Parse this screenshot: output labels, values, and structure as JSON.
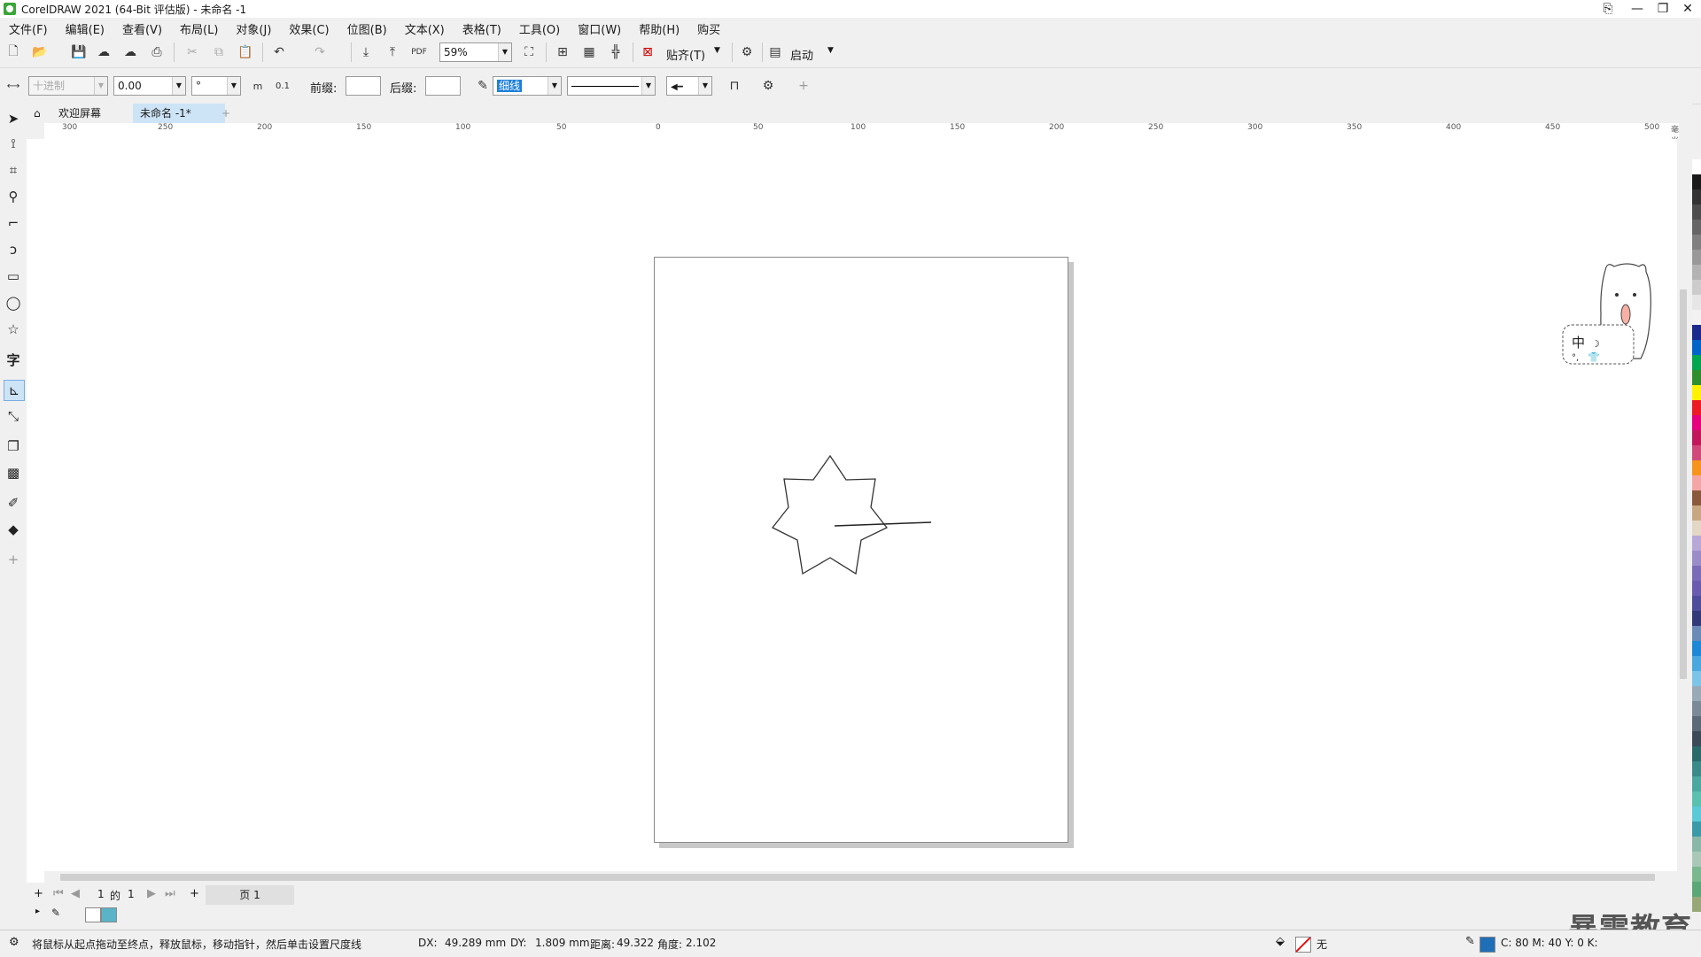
{
  "window": {
    "title": "CorelDRAW 2021 (64-Bit 评估版) - 未命名 -1"
  },
  "menu": [
    "文件(F)",
    "编辑(E)",
    "查看(V)",
    "布局(L)",
    "对象(J)",
    "效果(C)",
    "位图(B)",
    "文本(X)",
    "表格(T)",
    "工具(O)",
    "窗口(W)",
    "帮助(H)",
    "购买"
  ],
  "toolbar": {
    "zoom": "59%",
    "snap_label": "贴齐(T)",
    "launch_label": "启动"
  },
  "property_bar": {
    "units": "十进制",
    "value": "0.00",
    "degree": "°",
    "prefix_label": "前缀:",
    "suffix_label": "后缀:",
    "outline": "细线",
    "decimal_hint": "0.1",
    "unit_hint": "m"
  },
  "tabs": {
    "welcome": "欢迎屏幕",
    "document": "未命名 -1*"
  },
  "ruler_h": [
    "300",
    "250",
    "200",
    "150",
    "100",
    "50",
    "0",
    "50",
    "100",
    "150",
    "200",
    "250",
    "300",
    "350",
    "400",
    "450",
    "500"
  ],
  "ruler_h_unit": "毫米",
  "page_nav": {
    "current": "1",
    "of": "的",
    "total": "1",
    "page_tab": "页 1"
  },
  "status": {
    "hint": "将鼠标从起点拖动至终点，释放鼠标，移动指针，然后单击设置尺度线",
    "dx_label": "DX:",
    "dx": "49.289 mm",
    "dy_label": "DY:",
    "dy": "1.809 mm",
    "dist_label": "距离:",
    "dist": "49.322",
    "angle_label": "角度:",
    "angle": "2.102",
    "fill_none": "无",
    "cmyk": "C: 80 M: 40 Y: 0 K:"
  },
  "ime": {
    "lang": "中"
  },
  "watermark": "暴需教育",
  "colors": {
    "accent": "#3aa537",
    "selection": "#1e7fd8"
  },
  "palette": [
    "#ffffff",
    "#1a1a1a",
    "#333333",
    "#4d4d4d",
    "#666666",
    "#808080",
    "#999999",
    "#b3b3b3",
    "#cccccc",
    "#e6e6e6",
    "#f2f2f2",
    "#1b2a8c",
    "#0064c8",
    "#00a650",
    "#2f8f2f",
    "#fff200",
    "#ed1c24",
    "#e6007e",
    "#c2185b",
    "#d1497a",
    "#f7941d",
    "#f4a6a6",
    "#8b5a3c",
    "#c8a882",
    "#e5d7c5",
    "#b7a8d8",
    "#9a8cc9",
    "#7a6cb8",
    "#6a5ab0",
    "#4d4d9c",
    "#333a7a",
    "#6a8ab8",
    "#1e88d8",
    "#4aa8e0",
    "#7cc4e8",
    "#98aab8",
    "#7a8a98",
    "#5a6a78",
    "#3a4a58",
    "#2a6a6a",
    "#3a8a8a",
    "#4aa8a0",
    "#5ac0b0",
    "#5acad8",
    "#3a9aa8",
    "#8ab8a8",
    "#aac8b8",
    "#7ab890",
    "#5aa878",
    "#98a878"
  ]
}
